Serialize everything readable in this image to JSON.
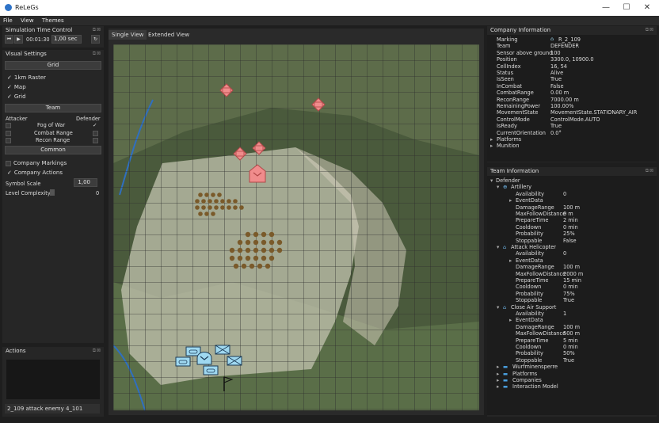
{
  "app": {
    "title": "ReLeGs"
  },
  "window_controls": {
    "minimize": "—",
    "maximize": "☐",
    "close": "✕"
  },
  "menu": [
    "File",
    "View",
    "Themes"
  ],
  "sim": {
    "title": "Simulation Time Control",
    "time": "00:01:30",
    "speed": "1,00 sec"
  },
  "visual": {
    "title": "Visual Settings",
    "grid_button": "Grid",
    "items": [
      "1km Raster",
      "Map",
      "Grid"
    ],
    "team_button": "Team",
    "attacker": "Attacker",
    "defender": "Defender",
    "team_rows": [
      "Fog of War",
      "Combat Range",
      "Recon Range"
    ],
    "common_button": "Common",
    "company_markings": "Company Markings",
    "company_actions": "Company Actions",
    "symbol_scale_label": "Symbol Scale",
    "symbol_scale_value": "1,00",
    "level_complexity_label": "Level Complexity",
    "level_complexity_value": "0"
  },
  "actions": {
    "title": "Actions",
    "log_entry": "2_109 attack enemy 4_101"
  },
  "tabs": [
    "Single View",
    "Extended View"
  ],
  "company": {
    "title": "Company Information",
    "rows": [
      [
        "Marking",
        "R_2_109"
      ],
      [
        "Team",
        "DEFENDER"
      ],
      [
        "Sensor above ground",
        "100"
      ],
      [
        "Position",
        "3300.0, 10900.0"
      ],
      [
        "CellIndex",
        "16, 54"
      ],
      [
        "Status",
        "Alive"
      ],
      [
        "IsSeen",
        "True"
      ],
      [
        "InCombat",
        "False"
      ],
      [
        "CombatRange",
        "0.00 m"
      ],
      [
        "ReconRange",
        "7000.00 m"
      ],
      [
        "RemainingPower",
        "100.00%"
      ],
      [
        "MovementState",
        "MovementState.STATIONARY_AIR"
      ],
      [
        "ControlMode",
        "ControlMode.AUTO"
      ],
      [
        "IsReady",
        "True"
      ],
      [
        "CurrentOrientation",
        "0.0°"
      ]
    ],
    "groups": [
      "Platforms",
      "Munition"
    ]
  },
  "team": {
    "title": "Team Information",
    "root": "Defender",
    "sections": [
      {
        "name": "Artillery",
        "availability": "0",
        "rows": [
          [
            "DamageRange",
            "100 m"
          ],
          [
            "MaxFollowDistance",
            "0 m"
          ],
          [
            "PrepareTime",
            "2 min"
          ],
          [
            "Cooldown",
            "0 min"
          ],
          [
            "Probability",
            "25%"
          ],
          [
            "Stoppable",
            "False"
          ]
        ]
      },
      {
        "name": "Attack Helicopter",
        "availability": "0",
        "rows": [
          [
            "DamageRange",
            "100 m"
          ],
          [
            "MaxFollowDistance",
            "2000 m"
          ],
          [
            "PrepareTime",
            "15 min"
          ],
          [
            "Cooldown",
            "0 min"
          ],
          [
            "Probability",
            "75%"
          ],
          [
            "Stoppable",
            "True"
          ]
        ]
      },
      {
        "name": "Close Air Support",
        "availability": "1",
        "rows": [
          [
            "DamageRange",
            "100 m"
          ],
          [
            "MaxFollowDistance",
            "500 m"
          ],
          [
            "PrepareTime",
            "5 min"
          ],
          [
            "Cooldown",
            "0 min"
          ],
          [
            "Probability",
            "50%"
          ],
          [
            "Stoppable",
            "True"
          ]
        ]
      }
    ],
    "availability_label": "Availability",
    "eventdata_label": "EventData",
    "footer_groups": [
      "Wurfminensperre",
      "Platforms",
      "Companies",
      "Interaction Model"
    ]
  },
  "colors": {
    "accent": "#2e73c8",
    "enemy_marker": "#f08c8c",
    "friendly_marker": "#9fd8f0"
  }
}
